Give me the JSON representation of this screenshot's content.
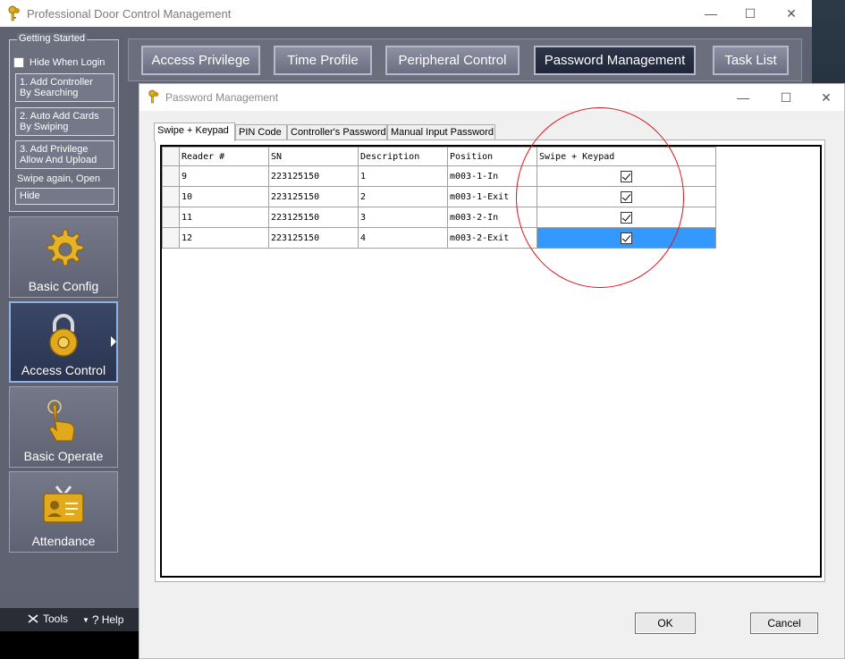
{
  "window": {
    "title": "Professional Door Control Management",
    "controls": {
      "minimize": "—",
      "maximize": "☐",
      "close": "✕"
    }
  },
  "sidebar": {
    "getting_started": {
      "title": "Getting Started",
      "hide_when_login": "Hide When Login",
      "steps": [
        {
          "line1": "1. Add Controller",
          "line2": "By Searching"
        },
        {
          "line1": "2. Auto Add Cards",
          "line2": "By Swiping"
        },
        {
          "line1": "3. Add Privilege",
          "line2": "Allow And Upload"
        }
      ],
      "swipe_again": "Swipe again, Open",
      "hide_label": "Hide"
    },
    "modules": [
      {
        "label": "Basic Config",
        "icon": "gear-icon"
      },
      {
        "label": "Access Control",
        "icon": "lock-icon",
        "active": true
      },
      {
        "label": "Basic Operate",
        "icon": "hand-icon"
      },
      {
        "label": "Attendance",
        "icon": "id-card-icon"
      }
    ],
    "bottom": {
      "tools": "Tools",
      "help": "Help"
    }
  },
  "top_nav": {
    "items": [
      "Access Privilege",
      "Time Profile",
      "Peripheral Control",
      "Password Management",
      "Task List"
    ],
    "selected": "Password Management"
  },
  "dialog": {
    "title": "Password Management",
    "tabs": [
      "Swipe + Keypad",
      "PIN Code",
      "Controller's Password",
      "Manual Input Password"
    ],
    "active_tab": "Swipe + Keypad",
    "table": {
      "columns": [
        "Reader #",
        "SN",
        "Description",
        "Position",
        "Swipe + Keypad"
      ],
      "rows": [
        {
          "reader": "9",
          "sn": "223125150",
          "description": "1",
          "position": "m003-1-In",
          "swipe_keypad": true
        },
        {
          "reader": "10",
          "sn": "223125150",
          "description": "2",
          "position": "m003-1-Exit",
          "swipe_keypad": true
        },
        {
          "reader": "11",
          "sn": "223125150",
          "description": "3",
          "position": "m003-2-In",
          "swipe_keypad": true
        },
        {
          "reader": "12",
          "sn": "223125150",
          "description": "4",
          "position": "m003-2-Exit",
          "swipe_keypad": true,
          "selected": true
        }
      ]
    },
    "ok_label": "OK",
    "cancel_label": "Cancel"
  },
  "colors": {
    "selection": "#3399ff",
    "annotation": "#e0141c",
    "sidebar_bg": "#5f6371",
    "nav_selected": "#20263a"
  }
}
